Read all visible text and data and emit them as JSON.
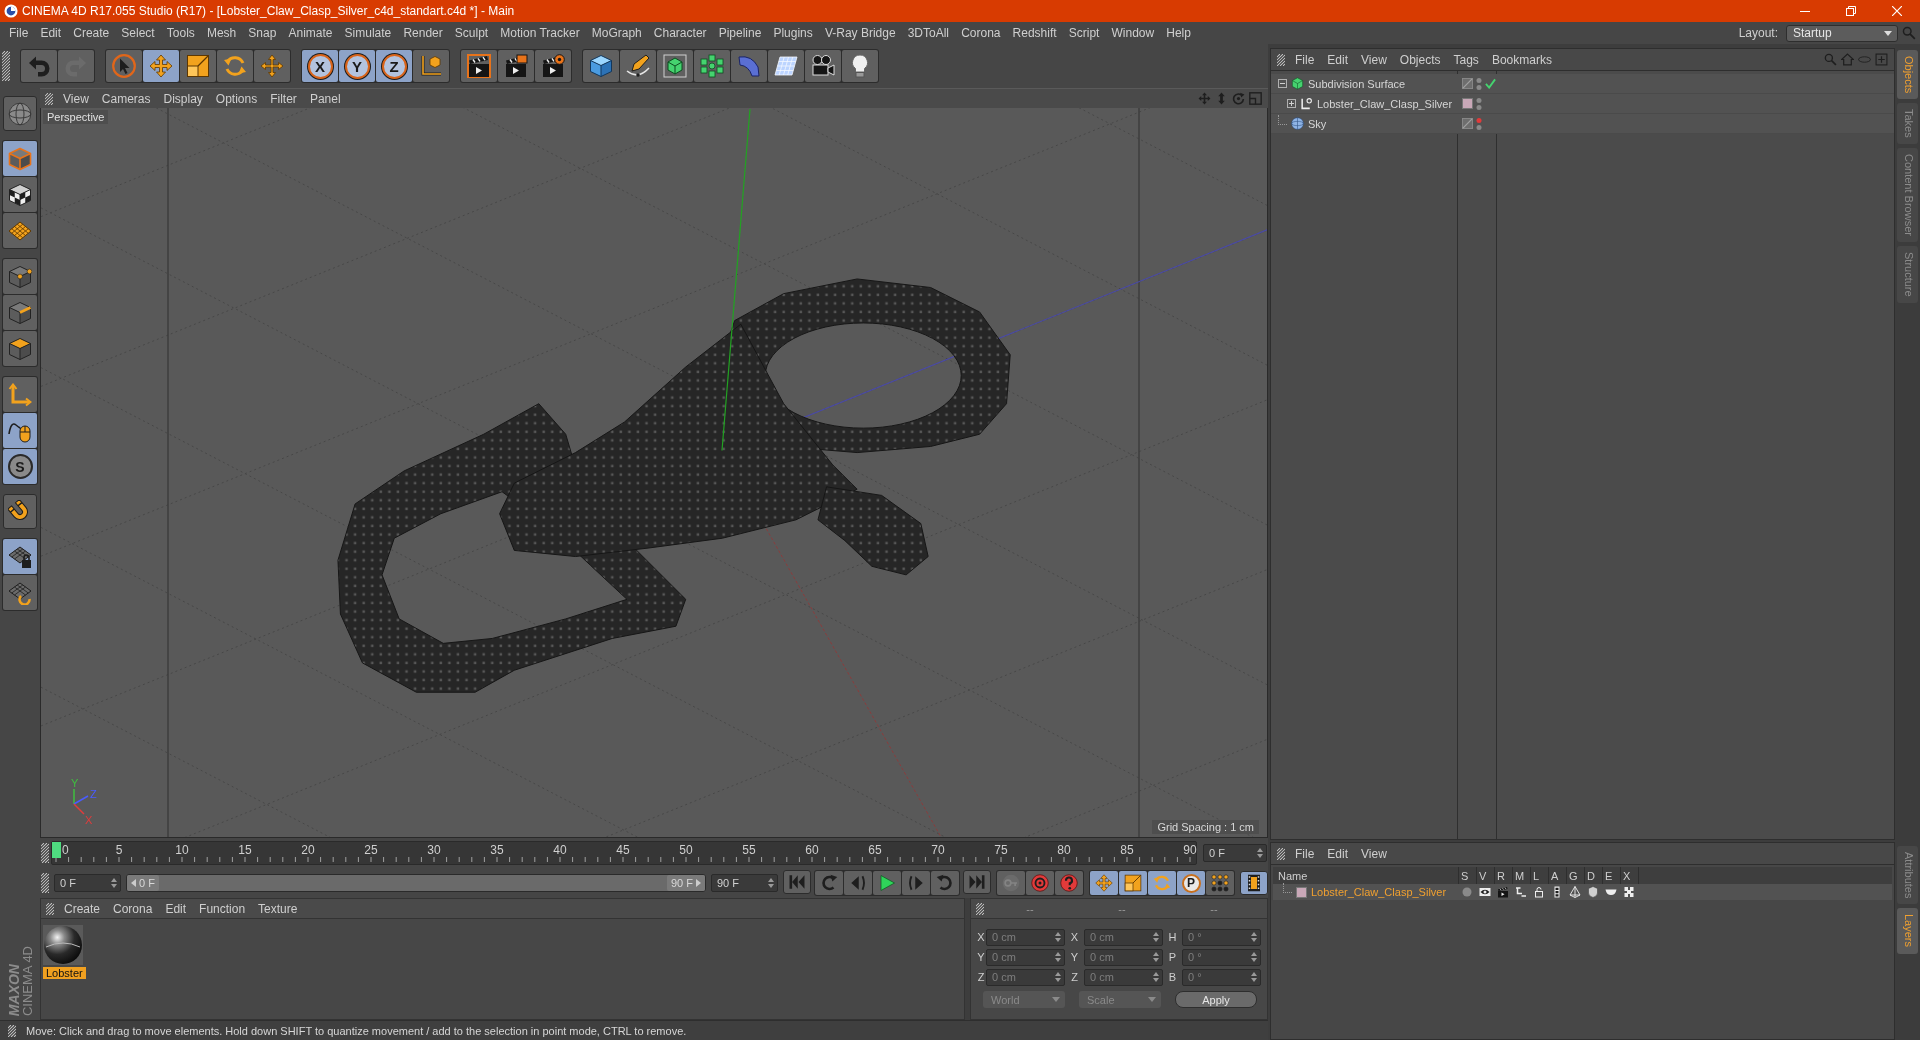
{
  "window": {
    "title": "CINEMA 4D R17.055 Studio (R17) - [Lobster_Claw_Clasp_Silver_c4d_standart.c4d *] - Main"
  },
  "menu": [
    "File",
    "Edit",
    "Create",
    "Select",
    "Tools",
    "Mesh",
    "Snap",
    "Animate",
    "Simulate",
    "Render",
    "Sculpt",
    "Motion Tracker",
    "MoGraph",
    "Character",
    "Pipeline",
    "Plugins",
    "V-Ray Bridge",
    "3DToAll",
    "Corona",
    "Redshift",
    "Script",
    "Window",
    "Help"
  ],
  "layout": {
    "label": "Layout:",
    "value": "Startup"
  },
  "toolbar": {
    "groups": [
      {
        "items": [
          {
            "kind": "undo",
            "selected": false,
            "disabled": false
          },
          {
            "kind": "redo",
            "selected": false,
            "disabled": true
          }
        ]
      },
      {
        "items": [
          {
            "kind": "select",
            "selected": false,
            "disabled": false
          },
          {
            "kind": "move",
            "selected": true,
            "disabled": false
          },
          {
            "kind": "scale",
            "selected": false,
            "disabled": false
          },
          {
            "kind": "rotate",
            "selected": false,
            "disabled": false
          },
          {
            "kind": "transform",
            "selected": false,
            "disabled": false
          }
        ]
      },
      {
        "items": [
          {
            "kind": "axis",
            "label": "X",
            "selected": true,
            "disabled": false
          },
          {
            "kind": "axis",
            "label": "Y",
            "selected": true,
            "disabled": false
          },
          {
            "kind": "axis",
            "label": "Z",
            "selected": true,
            "disabled": false
          },
          {
            "kind": "coords",
            "selected": false,
            "disabled": false
          }
        ]
      },
      {
        "items": [
          {
            "kind": "renderview",
            "selected": false,
            "disabled": false
          },
          {
            "kind": "renderpv",
            "selected": false,
            "disabled": false
          },
          {
            "kind": "rendersettings",
            "selected": false,
            "disabled": false
          }
        ]
      },
      {
        "items": [
          {
            "kind": "cube",
            "selected": false,
            "disabled": false
          },
          {
            "kind": "pen",
            "selected": false,
            "disabled": false
          },
          {
            "kind": "subdivision",
            "selected": false,
            "disabled": false
          },
          {
            "kind": "cloner",
            "selected": false,
            "disabled": false
          },
          {
            "kind": "deformer",
            "selected": false,
            "disabled": false
          },
          {
            "kind": "floor",
            "selected": false,
            "disabled": false
          },
          {
            "kind": "camera",
            "selected": false,
            "disabled": false
          },
          {
            "kind": "light",
            "selected": false,
            "disabled": false
          }
        ]
      }
    ]
  },
  "tool_palette": {
    "groups": [
      {
        "items": [
          {
            "kind": "sphere",
            "selected": false
          }
        ]
      },
      {
        "items": [
          {
            "kind": "model",
            "selected": true
          },
          {
            "kind": "texture",
            "selected": false
          },
          {
            "kind": "workplane",
            "selected": false
          }
        ]
      },
      {
        "items": [
          {
            "kind": "points",
            "selected": false
          },
          {
            "kind": "edges",
            "selected": false
          },
          {
            "kind": "polygons",
            "selected": false
          }
        ]
      },
      {
        "items": [
          {
            "kind": "axismode",
            "selected": false
          },
          {
            "kind": "tweak",
            "selected": true
          },
          {
            "kind": "solo",
            "label": "S",
            "selected": true
          }
        ]
      },
      {
        "items": [
          {
            "kind": "magnet",
            "selected": false
          }
        ]
      },
      {
        "items": [
          {
            "kind": "gridlock",
            "selected": true
          },
          {
            "kind": "gridrot",
            "selected": false
          }
        ]
      }
    ]
  },
  "brand": {
    "company": "MAXON",
    "product": "CINEMA 4D"
  },
  "viewport": {
    "menu": [
      "View",
      "Cameras",
      "Display",
      "Options",
      "Filter",
      "Panel"
    ],
    "camera": "Perspective",
    "grid_spacing": "Grid Spacing : 1 cm",
    "gizmo": [
      {
        "label": "Y",
        "color": "#3fbf3f"
      },
      {
        "label": "Z",
        "color": "#4a5cff"
      },
      {
        "label": "X",
        "color": "#e03c3c"
      }
    ]
  },
  "timeline": {
    "ruler": [
      "0",
      "5",
      "10",
      "15",
      "20",
      "25",
      "30",
      "35",
      "40",
      "45",
      "50",
      "55",
      "60",
      "65",
      "70",
      "75",
      "80",
      "85",
      "90"
    ],
    "playhead": {
      "level": 0
    },
    "current_frame": "0 F",
    "start_frame": "0 F",
    "range_start": "0 F",
    "range_end": "90 F",
    "end_frame": "90 F",
    "playback": [
      {
        "items": [
          {
            "kind": "start"
          }
        ]
      },
      {
        "items": [
          {
            "kind": "prevkey"
          },
          {
            "kind": "prevframe"
          },
          {
            "kind": "play"
          },
          {
            "kind": "nextframe"
          },
          {
            "kind": "nextkey"
          }
        ]
      },
      {
        "items": [
          {
            "kind": "end"
          }
        ]
      }
    ],
    "record": [
      {
        "kind": "key",
        "disabled": true
      },
      {
        "kind": "autokey",
        "disabled": false
      },
      {
        "kind": "keysel",
        "disabled": false
      }
    ],
    "key_modes": [
      {
        "kind": "move",
        "selected": true
      },
      {
        "kind": "scale",
        "selected": true
      },
      {
        "kind": "rotate",
        "selected": true
      },
      {
        "kind": "param",
        "label": "P",
        "selected": true
      },
      {
        "kind": "pla",
        "selected": false
      }
    ],
    "timeline_button": {
      "selected": true
    }
  },
  "material_manager": {
    "menu": [
      "Create",
      "Corona",
      "Edit",
      "Function",
      "Texture"
    ],
    "materials": [
      {
        "name": "Lobster",
        "selected": true
      }
    ]
  },
  "coordinates": {
    "headers": [
      "--",
      "--",
      "--"
    ],
    "disabled": true,
    "rows": [
      {
        "position_axis": "X",
        "position": "0 cm",
        "size_axis": "X",
        "size": "0 cm",
        "rotation_axis": "H",
        "rotation": "0 °"
      },
      {
        "position_axis": "Y",
        "position": "0 cm",
        "size_axis": "Y",
        "size": "0 cm",
        "rotation_axis": "P",
        "rotation": "0 °"
      },
      {
        "position_axis": "Z",
        "position": "0 cm",
        "size_axis": "Z",
        "size": "0 cm",
        "rotation_axis": "B",
        "rotation": "0 °"
      }
    ],
    "mode": "World",
    "size_mode": "Scale",
    "apply": "Apply"
  },
  "status_bar": "Move: Click and drag to move elements. Hold down SHIFT to quantize movement / add to the selection in point mode, CTRL to remove.",
  "object_manager": {
    "menu": [
      "File",
      "Edit",
      "View",
      "Objects",
      "Tags",
      "Bookmarks"
    ],
    "objects": [
      {
        "kind": "subdivision",
        "name": "Subdivision Surface",
        "expanded": true,
        "enabled": true,
        "editor_hidden": false,
        "children": [
          {
            "kind": "null",
            "name": "Lobster_Claw_Clasp_Silver",
            "expanded": false,
            "color": "#c9a8b8",
            "editor_hidden": false
          }
        ]
      },
      {
        "kind": "sky",
        "name": "Sky",
        "editor_hidden": true
      }
    ]
  },
  "layer_manager": {
    "menu": [
      "File",
      "Edit",
      "View"
    ],
    "columns": [
      {
        "label": "Name",
        "kind": "name"
      },
      {
        "label": "S",
        "kind": "solo"
      },
      {
        "label": "V",
        "kind": "visible"
      },
      {
        "label": "R",
        "kind": "render"
      },
      {
        "label": "M",
        "kind": "manager"
      },
      {
        "label": "L",
        "kind": "lock"
      },
      {
        "label": "A",
        "kind": "animation"
      },
      {
        "label": "G",
        "kind": "generators"
      },
      {
        "label": "D",
        "kind": "deformers"
      },
      {
        "label": "E",
        "kind": "expressions"
      },
      {
        "label": "X",
        "kind": "xref"
      }
    ],
    "layers": [
      {
        "name": "Lobster_Claw_Clasp_Silver",
        "color": "#c9a8b8",
        "selected": true
      }
    ]
  },
  "side_tabs": {
    "top": [
      {
        "label": "Objects",
        "selected": true
      },
      {
        "label": "Takes",
        "selected": false
      },
      {
        "label": "Content Browser",
        "selected": false
      },
      {
        "label": "Structure",
        "selected": false
      }
    ],
    "bottom": [
      {
        "label": "Attributes",
        "selected": false
      },
      {
        "label": "Layers",
        "selected": true
      }
    ]
  }
}
